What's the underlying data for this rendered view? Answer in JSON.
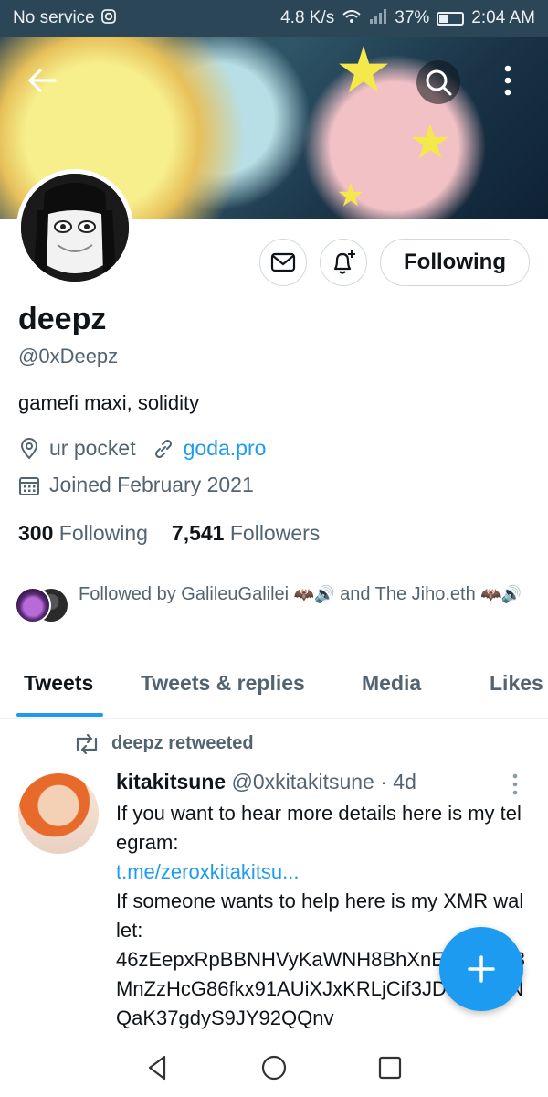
{
  "status_bar": {
    "carrier": "No service",
    "speed": "4.8 K/s",
    "battery": "37%",
    "battery_level": 0.37,
    "time": "2:04 AM"
  },
  "header": {
    "back_icon": "back-arrow-icon",
    "search_icon": "search-icon",
    "more_icon": "more-vertical-icon"
  },
  "profile": {
    "display_name": "deepz",
    "handle": "@0xDeepz",
    "bio": "gamefi maxi, solidity",
    "location": "ur pocket",
    "website": "goda.pro",
    "joined": "Joined February 2021",
    "following_count": "300",
    "following_label": "Following",
    "followers_count": "7,541",
    "followers_label": "Followers",
    "follow_button": "Following",
    "followed_by": "Followed by GalileuGalilei",
    "followed_by_and": "and The Jiho.eth"
  },
  "tabs": [
    {
      "label": "Tweets",
      "active": true
    },
    {
      "label": "Tweets & replies",
      "active": false
    },
    {
      "label": "Media",
      "active": false
    },
    {
      "label": "Likes",
      "active": false
    }
  ],
  "tweet": {
    "retweet_label": "deepz retweeted",
    "author": "kitakitsune",
    "author_handle": "@0xkitakitsune",
    "time": "· 4d",
    "line1": "If you want to hear more details here is my telegram:",
    "link": "t.me/zeroxkitakitsu...",
    "line2": "If someone wants to help here is my XMR wallet:",
    "wallet": "46zEepxRpBBNHVyKaWNH8BhXnEVJ7hWi3MnZzHcG86fkx91AUiXJxKRLjCif3JDJoHxtLNQaK37gdyS9JY92QQnv"
  },
  "colors": {
    "accent": "#1d9bf0",
    "status_bar": "#2b4656",
    "secondary_text": "#536471"
  }
}
